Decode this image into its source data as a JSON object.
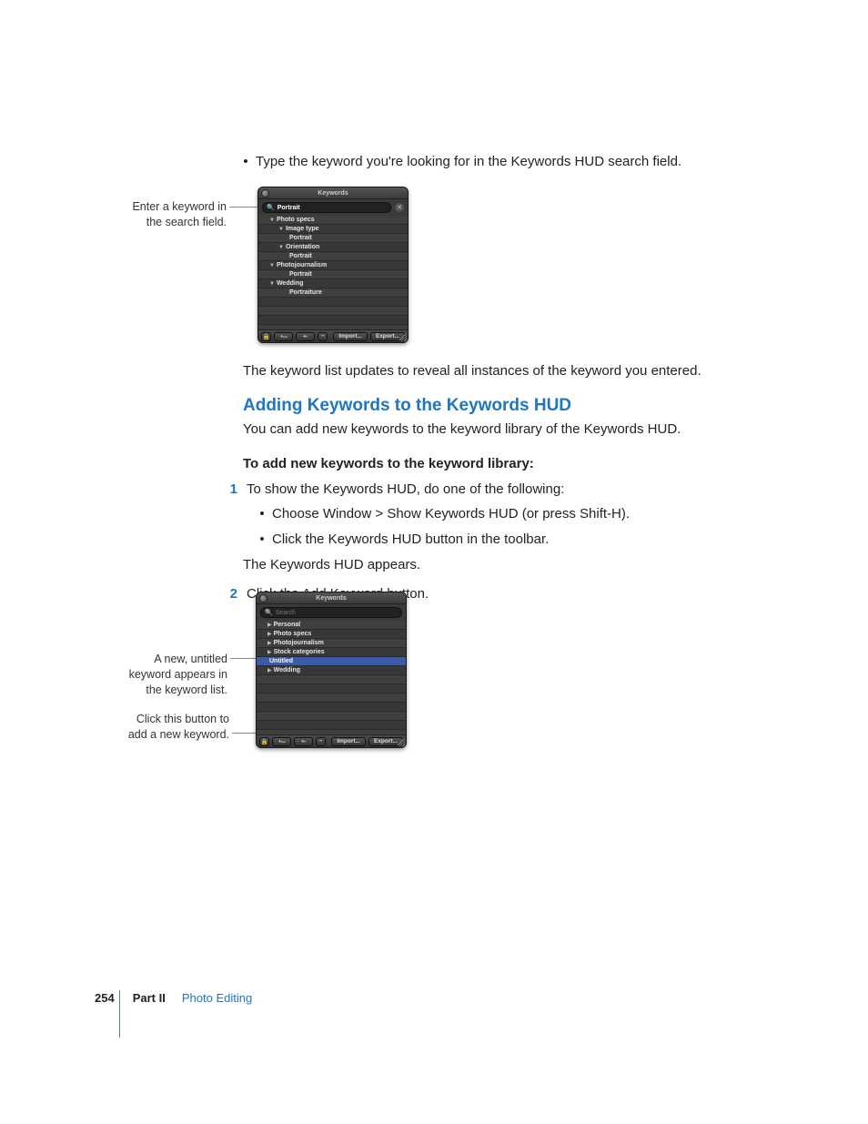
{
  "intro_bullet": "Type the keyword you're looking for in the Keywords HUD search field.",
  "callouts": {
    "c1a": "Enter a keyword in",
    "c1b": "the search field.",
    "c2a": "A new, untitled",
    "c2b": "keyword appears in",
    "c2c": "the keyword list.",
    "c3a": "Click this button to",
    "c3b": "add a new keyword."
  },
  "hud1": {
    "title": "Keywords",
    "search_value": "Portrait",
    "rows": [
      {
        "indent": 1,
        "tri": "down",
        "label": "Photo specs"
      },
      {
        "indent": 2,
        "tri": "down",
        "label": "Image type"
      },
      {
        "indent": 3,
        "tri": "",
        "label": "Portrait"
      },
      {
        "indent": 2,
        "tri": "down",
        "label": "Orientation"
      },
      {
        "indent": 3,
        "tri": "",
        "label": "Portrait"
      },
      {
        "indent": 1,
        "tri": "down",
        "label": "Photojournalism"
      },
      {
        "indent": 3,
        "tri": "",
        "label": "Portrait"
      },
      {
        "indent": 1,
        "tri": "down",
        "label": "Wedding"
      },
      {
        "indent": 3,
        "tri": "",
        "label": "Portraiture"
      }
    ],
    "footer": {
      "import": "Import...",
      "export": "Export..."
    }
  },
  "after_hud1": "The keyword list updates to reveal all instances of the keyword you entered.",
  "section_heading": "Adding Keywords to the Keywords HUD",
  "section_intro": "You can add new keywords to the keyword library of the Keywords HUD.",
  "procedure_title": "To add new keywords to the keyword library:",
  "step1_num": "1",
  "step1": "To show the Keywords HUD, do one of the following:",
  "step1_b1": "Choose Window > Show Keywords HUD (or press Shift-H).",
  "step1_b2": "Click the Keywords HUD button in the toolbar.",
  "step1_after": "The Keywords HUD appears.",
  "step2_num": "2",
  "step2": "Click the Add Keyword button.",
  "hud2": {
    "title": "Keywords",
    "search_placeholder": "Search",
    "rows": [
      {
        "indent": 1,
        "tri": "right",
        "label": "Personal"
      },
      {
        "indent": 1,
        "tri": "right",
        "label": "Photo specs"
      },
      {
        "indent": 1,
        "tri": "right",
        "label": "Photojournalism"
      },
      {
        "indent": 1,
        "tri": "right",
        "label": "Stock categories"
      },
      {
        "indent": 1,
        "tri": "",
        "label": "Untitled",
        "selected": true
      },
      {
        "indent": 1,
        "tri": "right",
        "label": "Wedding"
      }
    ],
    "footer": {
      "import": "Import...",
      "export": "Export..."
    }
  },
  "footer": {
    "page": "254",
    "part": "Part II",
    "chapter": "Photo Editing"
  }
}
